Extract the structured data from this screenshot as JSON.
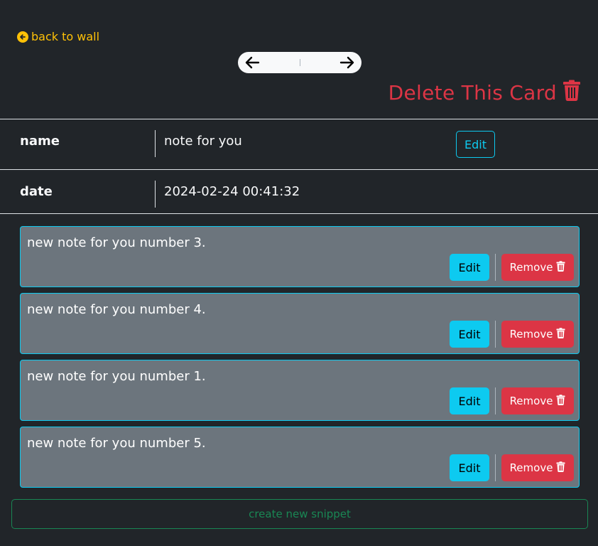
{
  "header": {
    "back_label": "back to wall",
    "delete_card_label": "Delete This Card"
  },
  "fields": [
    {
      "label": "name",
      "value": "note for you",
      "edit_label": "Edit"
    },
    {
      "label": "date",
      "value": "2024-02-24 00:41:32"
    }
  ],
  "snippets": [
    {
      "text": "new note for you number 3.",
      "edit_label": "Edit",
      "remove_label": "Remove"
    },
    {
      "text": "new note for you number 4.",
      "edit_label": "Edit",
      "remove_label": "Remove"
    },
    {
      "text": "new note for you number 1.",
      "edit_label": "Edit",
      "remove_label": "Remove"
    },
    {
      "text": "new note for you number 5.",
      "edit_label": "Edit",
      "remove_label": "Remove"
    }
  ],
  "create_label": "create new snippet",
  "colors": {
    "background": "#212529",
    "warning": "#ffc107",
    "danger": "#dc3545",
    "info": "#0dcaf0",
    "success": "#198754",
    "snippet_bg": "#6c757d"
  }
}
